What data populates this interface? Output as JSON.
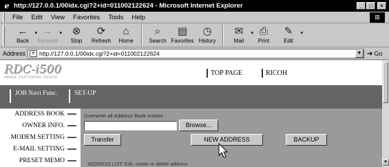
{
  "window": {
    "title": "http://127.0.0.1/00idx.cgi?2+id=011002122624 - Microsoft Internet Explorer"
  },
  "menu": [
    "File",
    "Edit",
    "View",
    "Favorites",
    "Tools",
    "Help"
  ],
  "toolbar": {
    "buttons": [
      {
        "label": "Back",
        "icon": "back-arrow-icon"
      },
      {
        "label": "Forward",
        "icon": "forward-arrow-icon"
      },
      {
        "label": "Stop",
        "icon": "stop-icon"
      },
      {
        "label": "Refresh",
        "icon": "refresh-icon"
      },
      {
        "label": "Home",
        "icon": "home-icon"
      },
      {
        "label": "Search",
        "icon": "search-icon"
      },
      {
        "label": "Favorites",
        "icon": "favorites-icon"
      },
      {
        "label": "History",
        "icon": "history-icon"
      },
      {
        "label": "Mail",
        "icon": "mail-icon"
      },
      {
        "label": "Print",
        "icon": "print-icon"
      },
      {
        "label": "Edit",
        "icon": "edit-icon"
      }
    ]
  },
  "address": {
    "label": "Address",
    "url": "http://127.0.0.1/00idx.cgi?2+id=011002122624",
    "go_label": "Go"
  },
  "page": {
    "brand": {
      "logo": "RDC-i500",
      "tagline": "IMAGE CAPTURING DEVICE"
    },
    "top_links": [
      "TOP PAGE",
      "RICOH"
    ],
    "nav_tabs": [
      "JOB Navi Func.",
      "SET-UP"
    ],
    "sidebar": [
      "ADDRESS BOOK",
      "OWNER INFO.",
      "MODEM SETTING",
      "E-MAIL SETTING",
      "PRESET MEMO"
    ],
    "panel": {
      "caption": "Overwrite all Address Book entries",
      "file_value": "",
      "browse_label": "Browse...",
      "transfer_label": "Transfer",
      "new_address_label": "NEW ADDRESS",
      "backup_label": "BACKUP",
      "footer_text": "ADDRESS LIST: Edit, create or delete address"
    }
  },
  "colors": {
    "nav_band": "#646464",
    "panel": "#9a9a9a",
    "chrome": "#c8c8c8"
  }
}
